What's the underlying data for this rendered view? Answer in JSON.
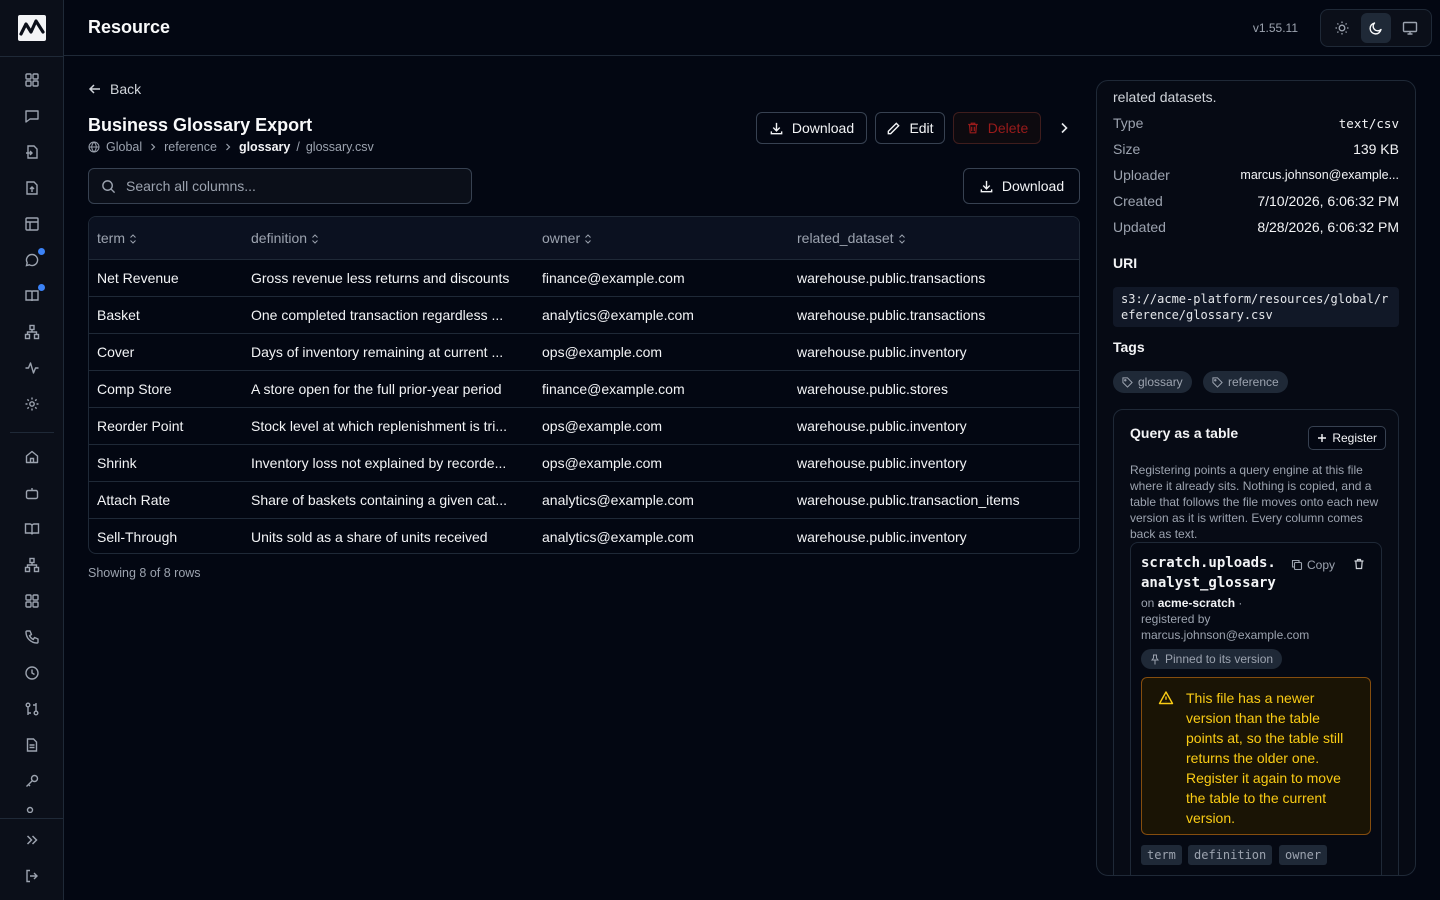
{
  "app": {
    "title": "Resource",
    "version": "v1.55.11"
  },
  "page": {
    "back_label": "Back",
    "title": "Business Glossary Export",
    "breadcrumb": [
      "Global",
      "reference",
      "glossary",
      "glossary.csv"
    ],
    "actions": {
      "download": "Download",
      "edit": "Edit",
      "delete": "Delete"
    }
  },
  "search": {
    "placeholder": "Search all columns...",
    "value": ""
  },
  "toolbar": {
    "download": "Download"
  },
  "table": {
    "columns": [
      "term",
      "definition",
      "owner",
      "related_dataset"
    ],
    "rows": [
      [
        "Net Revenue",
        "Gross revenue less returns and discounts",
        "finance@example.com",
        "warehouse.public.transactions"
      ],
      [
        "Basket",
        "One completed transaction regardless ...",
        "analytics@example.com",
        "warehouse.public.transactions"
      ],
      [
        "Cover",
        "Days of inventory remaining at current ...",
        "ops@example.com",
        "warehouse.public.inventory"
      ],
      [
        "Comp Store",
        "A store open for the full prior-year period",
        "finance@example.com",
        "warehouse.public.stores"
      ],
      [
        "Reorder Point",
        "Stock level at which replenishment is tri...",
        "ops@example.com",
        "warehouse.public.inventory"
      ],
      [
        "Shrink",
        "Inventory loss not explained by recorde...",
        "ops@example.com",
        "warehouse.public.inventory"
      ],
      [
        "Attach Rate",
        "Share of baskets containing a given cat...",
        "analytics@example.com",
        "warehouse.public.transaction_items"
      ],
      [
        "Sell-Through",
        "Units sold as a share of units received",
        "analytics@example.com",
        "warehouse.public.inventory"
      ]
    ],
    "footer": "Showing 8 of 8 rows"
  },
  "details": {
    "description_tail": "related datasets.",
    "meta": [
      {
        "key": "Type",
        "value": "text/csv"
      },
      {
        "key": "Size",
        "value": "139 KB"
      },
      {
        "key": "Uploader",
        "value": "marcus.johnson@example..."
      },
      {
        "key": "Created",
        "value": "7/10/2026, 6:06:32 PM"
      },
      {
        "key": "Updated",
        "value": "8/28/2026, 6:06:32 PM"
      }
    ],
    "uri_label": "URI",
    "uri": "s3://acme-platform/resources/global/reference/glossary.csv",
    "tags_label": "Tags",
    "tags": [
      "glossary",
      "reference"
    ]
  },
  "query": {
    "title": "Query as a table",
    "register_label": "Register",
    "description": "Registering points a query engine at this file where it already sits. Nothing is copied, and a table that follows the file moves onto each new version as it is written. Every column comes back as text.",
    "table_name_line1": "scratch.uploads.",
    "table_name_line2": "analyst_glossary",
    "copy_label": "Copy",
    "on_prefix": "on",
    "catalog": "acme-scratch",
    "registered_by_label": "registered by",
    "registered_by": "marcus.johnson@example.com",
    "pinned_label": "Pinned to its version",
    "warning": "This file has a newer version than the table points at, so the table still returns the older one. Register it again to move the table to the current version.",
    "columns": [
      "term",
      "definition",
      "owner"
    ]
  },
  "colors": {
    "background": "#030712",
    "accent_dot": "#3b82f6",
    "warning": "#facc15",
    "danger": "#991b1b"
  },
  "icons": {
    "sidebar": [
      "dashboard-icon",
      "chat-icon",
      "import-icon",
      "upload-file-icon",
      "table-icon",
      "chat-bubble-icon",
      "book-icon",
      "hierarchy-icon",
      "activity-icon",
      "settings-icon",
      "home-icon",
      "bot-icon",
      "open-book-icon",
      "network-icon",
      "grid-icon",
      "phone-icon",
      "clock-icon",
      "compare-icon",
      "document-icon",
      "key-icon",
      "users-icon"
    ]
  }
}
